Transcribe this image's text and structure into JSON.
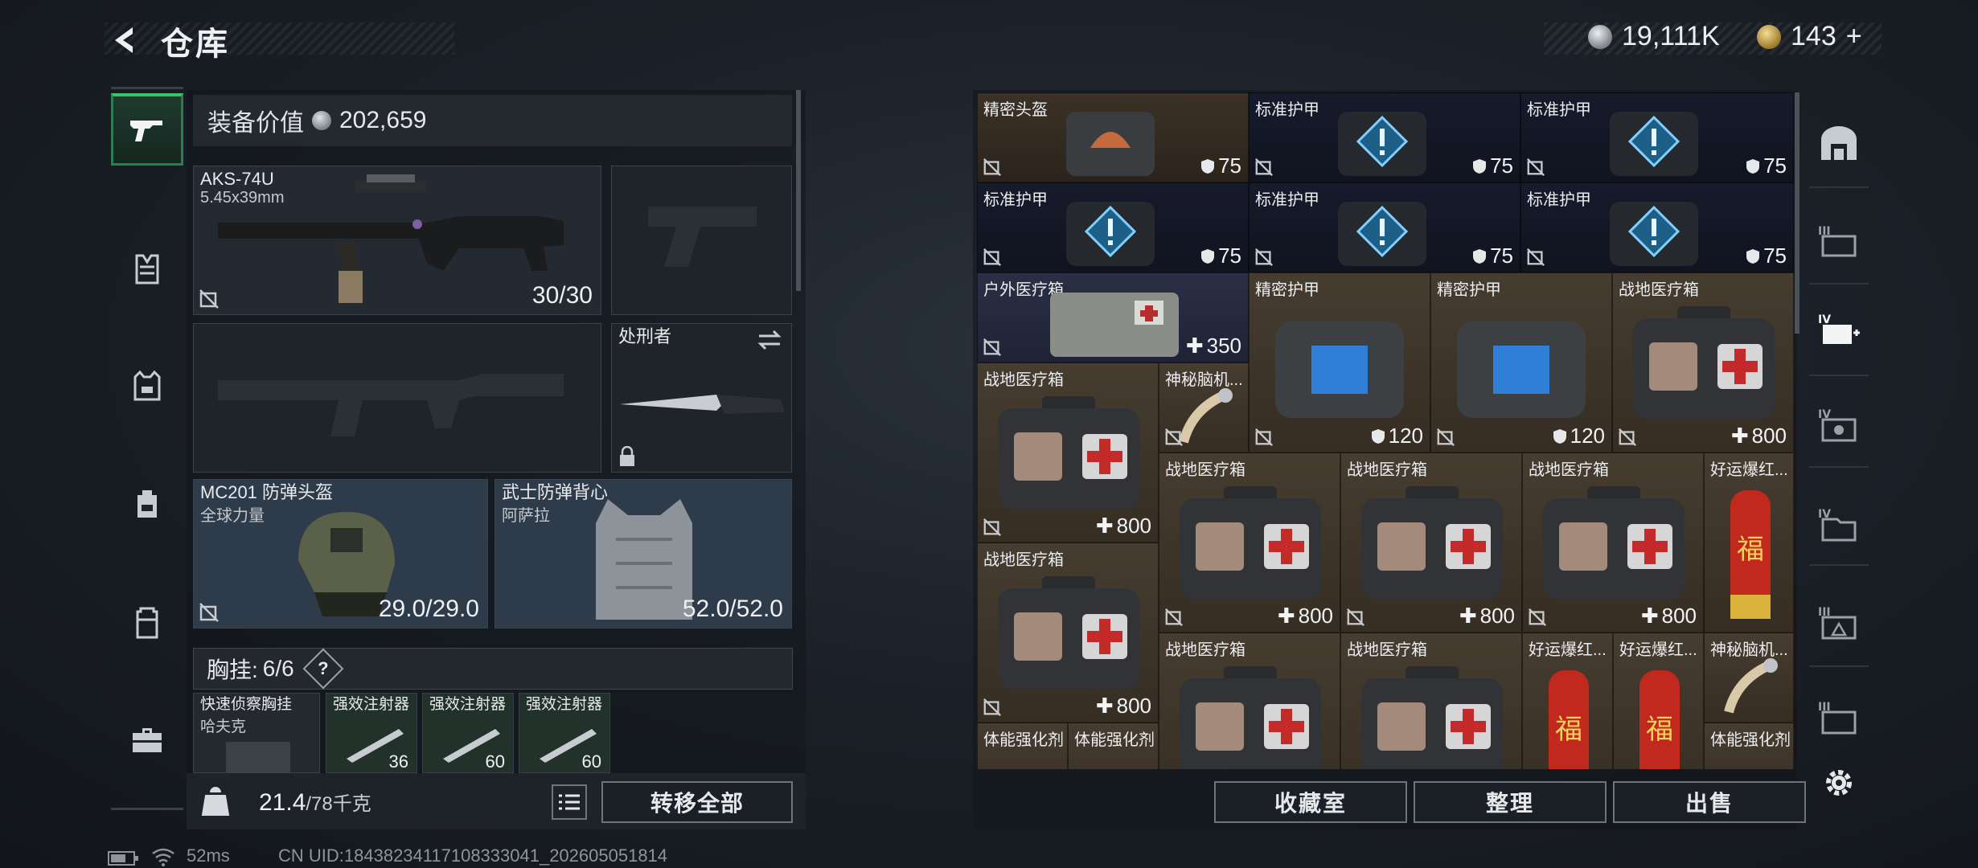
{
  "header": {
    "title": "仓库"
  },
  "currencies": [
    {
      "name": "silver-coin-icon",
      "value": "19,111K",
      "color": "#c5c9cd"
    },
    {
      "name": "gold-coin-icon",
      "value": "143",
      "plus": "+",
      "color": "#d8b45a"
    }
  ],
  "rail": {
    "items": [
      "gun-icon",
      "chest-rig-icon",
      "armor-vest-icon",
      "backpack-icon",
      "pouch-icon",
      "toolbox-icon"
    ]
  },
  "loadout": {
    "equip_value_label": "装备价值",
    "equip_value": "202,659",
    "primary": {
      "name": "AKS-74U",
      "caliber": "5.45x39mm",
      "ammo": "30/30"
    },
    "melee": {
      "name": "处刑者"
    },
    "helmet": {
      "name": "MC201 防弹头盔",
      "sub": "全球力量",
      "durability": "29.0/29.0"
    },
    "armor": {
      "name": "武士防弹背心",
      "sub": "阿萨拉",
      "durability": "52.0/52.0"
    },
    "chest_label": "胸挂:",
    "chest_count": "6/6",
    "help": "?",
    "rig_items": [
      {
        "name": "快速侦察胸挂",
        "sub": "哈夫克"
      },
      {
        "name": "强效注射器",
        "val": "36"
      },
      {
        "name": "强效注射器",
        "val": "60"
      },
      {
        "name": "强效注射器",
        "val": "60"
      }
    ],
    "weight": "21.4",
    "weight_max": "/78千克",
    "transfer_all": "转移全部"
  },
  "storage": {
    "row1": [
      {
        "name": "精密头盔",
        "val": "75"
      },
      {
        "name": "标准护甲",
        "val": "75"
      },
      {
        "name": "标准护甲",
        "val": "75"
      }
    ],
    "row2": [
      {
        "name": "标准护甲",
        "val": "75"
      },
      {
        "name": "标准护甲",
        "val": "75"
      },
      {
        "name": "标准护甲",
        "val": "75"
      }
    ],
    "outdoor": {
      "name": "户外医疗箱",
      "val": "350"
    },
    "armorA": {
      "name": "精密护甲",
      "val": "120"
    },
    "armorB": {
      "name": "精密护甲",
      "val": "120"
    },
    "fieldTop": {
      "name": "战地医疗箱",
      "val": "800"
    },
    "fieldL1": {
      "name": "战地医疗箱",
      "val": "800"
    },
    "mystery1": {
      "name": "神秘脑机..."
    },
    "fieldM1": {
      "name": "战地医疗箱",
      "val": "800"
    },
    "fieldM2": {
      "name": "战地医疗箱",
      "val": "800"
    },
    "fieldM3": {
      "name": "战地医疗箱",
      "val": "800"
    },
    "lucky1": {
      "name": "好运爆红..."
    },
    "fieldL2": {
      "name": "战地医疗箱",
      "val": "800"
    },
    "fieldB1": {
      "name": "战地医疗箱"
    },
    "fieldB2": {
      "name": "战地医疗箱"
    },
    "lucky2": {
      "name": "好运爆红..."
    },
    "lucky3": {
      "name": "好运爆红..."
    },
    "mystery2": {
      "name": "神秘脑机..."
    },
    "stim1": {
      "name": "体能强化剂"
    },
    "stim2": {
      "name": "体能强化剂"
    },
    "stim3": {
      "name": "体能强化剂"
    }
  },
  "buttons": {
    "collection": "收藏室",
    "organize": "整理",
    "sell": "出售"
  },
  "right_tabs": [
    "III",
    "IV",
    "IV",
    "IV",
    "III",
    "III"
  ],
  "status": {
    "ping": "52ms",
    "uid": "CN UID:18438234117108333041_202605051814"
  }
}
